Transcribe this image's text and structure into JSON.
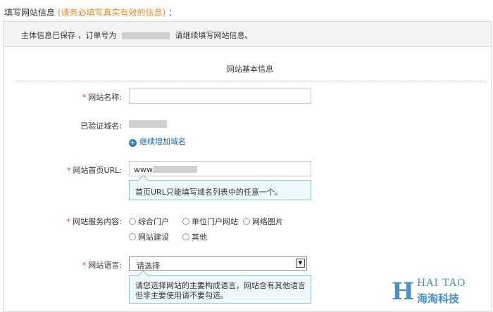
{
  "header": {
    "title": "填写网站信息",
    "note": "(请务必填写真实有效的信息)",
    "colon": "："
  },
  "notice": {
    "prefix": "主体信息已保存 ，订单号为",
    "suffix": "请继续填写网站信息。"
  },
  "section": {
    "title": "网站基本信息"
  },
  "fields": {
    "site_name": {
      "label": "网站名称:",
      "value": ""
    },
    "verified_domain": {
      "label": "已验证域名:"
    },
    "add_domain": {
      "label": "继续增加域名"
    },
    "home_url": {
      "label": "网站首页URL:",
      "value_prefix": "www.",
      "tip": "首页URL只能填写域名列表中的任意一个。"
    },
    "service": {
      "label": "网站服务内容:",
      "options": [
        "综合门户",
        "单位门户网站",
        "网络图片",
        "网站建设",
        "其他"
      ]
    },
    "language": {
      "label": "网站语言:",
      "selected": "请选择",
      "tip_line1": "请您选择网站的主要构成语言，网站含有其他语言",
      "tip_line2": "但非主要使用请不要勾选。"
    }
  },
  "watermark": {
    "letter": "H",
    "en": "HAI TAO",
    "cn": "海淘科技"
  },
  "colors": {
    "accent": "#f08c25",
    "required": "#ee3333",
    "link": "#1a64a8",
    "tip_border": "#7ec4d8"
  }
}
